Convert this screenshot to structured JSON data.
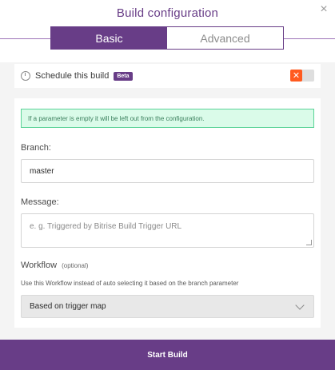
{
  "dialog": {
    "title": "Build configuration",
    "close": "×"
  },
  "tabs": [
    {
      "label": "Basic",
      "active": true
    },
    {
      "label": "Advanced",
      "active": false
    }
  ],
  "schedule": {
    "label": "Schedule this build",
    "badge": "Beta",
    "toggle_on": false,
    "toggle_glyph": "✕"
  },
  "notice": "If a parameter is empty it will be left out from the configuration.",
  "branch": {
    "label": "Branch:",
    "value": "master"
  },
  "message": {
    "label": "Message:",
    "placeholder": "e. g. Triggered by Bitrise Build Trigger URL"
  },
  "workflow": {
    "label": "Workflow",
    "optional": "(optional)",
    "hint": "Use this Workflow instead of auto selecting it based on the branch parameter",
    "selected": "Based on trigger map"
  },
  "start_button": "Start Build",
  "colors": {
    "accent": "#683d87",
    "toggle_off": "#ff5a1f",
    "notice_bg": "#dafbe9",
    "notice_border": "#5ad397"
  },
  "icons": {
    "close": "close-icon",
    "clock": "clock-icon",
    "chevron": "chevron-down-icon"
  }
}
